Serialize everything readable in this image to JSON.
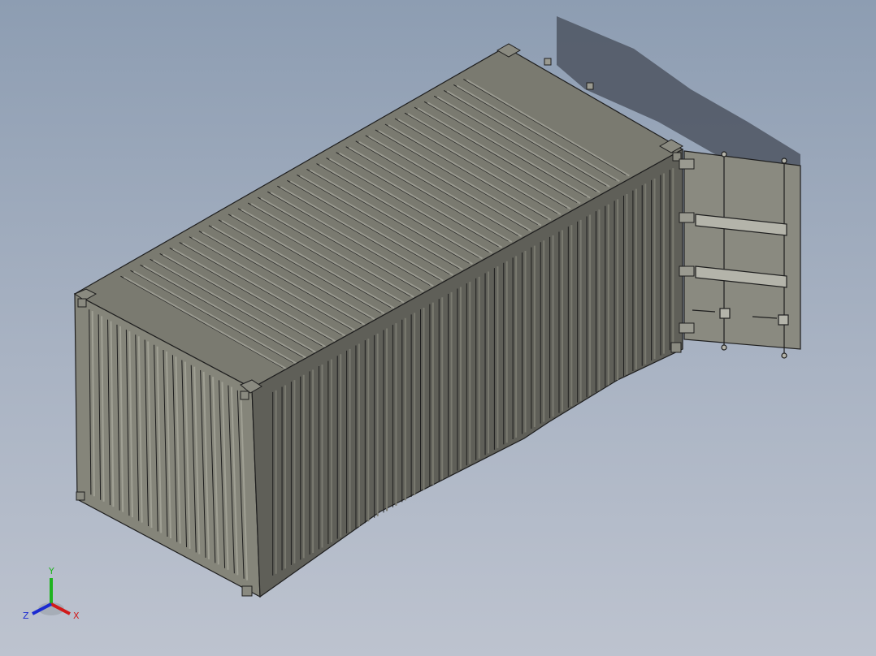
{
  "viewport": {
    "background_top": "#8d9db2",
    "background_bottom": "#bdc3cf"
  },
  "model": {
    "body_color": "#6e6e66",
    "top_color": "#7a7a70",
    "end_color": "#85857a",
    "side_color": "#5f5f58",
    "door_color": "#8a8a80",
    "edge_color": "#1e1e1e"
  },
  "triad": {
    "y_label": "Y",
    "x_label": "X",
    "z_label": "Z",
    "y_color": "#1fb31f",
    "x_color": "#d11a1a",
    "z_color": "#1a2ad1"
  }
}
